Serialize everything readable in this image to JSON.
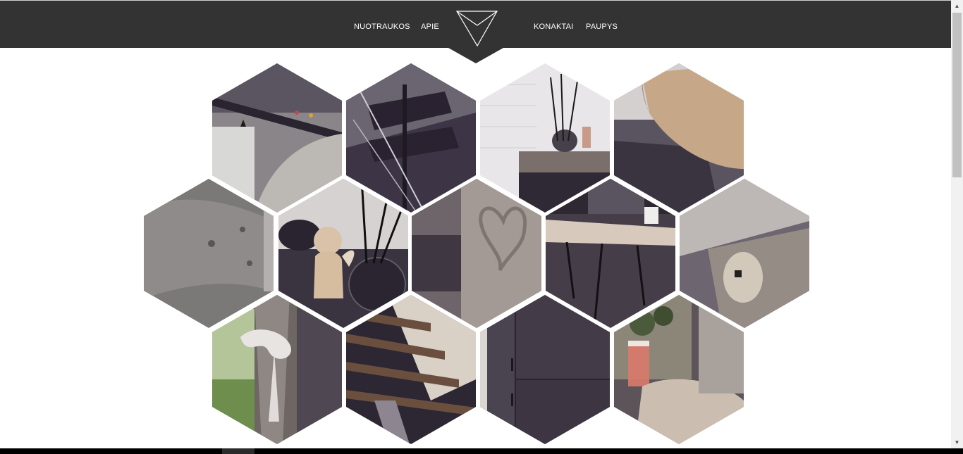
{
  "nav": {
    "items": [
      {
        "label": "NUOTRAUKOS"
      },
      {
        "label": "APIE"
      },
      {
        "label": "KONAKTAI"
      },
      {
        "label": "PAUPYS"
      }
    ],
    "logo_icon": "triangle-logo-icon"
  },
  "colors": {
    "navbar": "#333333",
    "nav_text": "#ffffff",
    "page_background": "#ffffff",
    "photo_tint": "#4a4052"
  },
  "gallery": {
    "photos": [
      {
        "subject": "shelf-lamp"
      },
      {
        "subject": "stairs-vase"
      },
      {
        "subject": "diffuser-tiles"
      },
      {
        "subject": "wood-table-top"
      },
      {
        "subject": "grey-sofa"
      },
      {
        "subject": "angel-figurine"
      },
      {
        "subject": "heart-wood"
      },
      {
        "subject": "coffee-table"
      },
      {
        "subject": "wall-lamp"
      },
      {
        "subject": "curtain-ribbon"
      },
      {
        "subject": "wooden-stairs"
      },
      {
        "subject": "dark-cabinets"
      },
      {
        "subject": "window-plants"
      }
    ]
  }
}
